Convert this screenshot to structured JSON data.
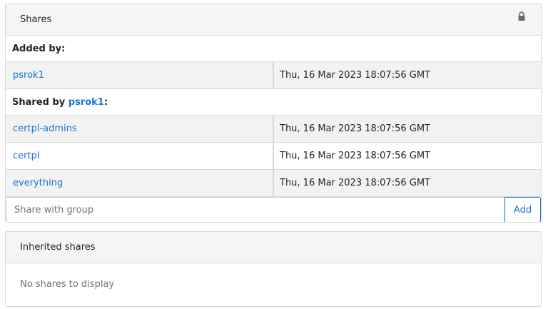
{
  "shares_panel": {
    "title": "Shares",
    "lock_icon": "lock-icon",
    "added_by": {
      "heading": "Added by:",
      "user": "psrok1",
      "date": "Thu, 16 Mar 2023 18:07:56 GMT"
    },
    "shared_by": {
      "heading_prefix": "Shared by ",
      "user": "psrok1",
      "heading_suffix": ":",
      "rows": [
        {
          "group": "certpl-admins",
          "date": "Thu, 16 Mar 2023 18:07:56 GMT"
        },
        {
          "group": "certpl",
          "date": "Thu, 16 Mar 2023 18:07:56 GMT"
        },
        {
          "group": "everything",
          "date": "Thu, 16 Mar 2023 18:07:56 GMT"
        }
      ]
    },
    "share_input": {
      "placeholder": "Share with group",
      "value": ""
    },
    "add_label": "Add"
  },
  "inherited_panel": {
    "title": "Inherited shares",
    "empty_text": "No shares to display"
  }
}
